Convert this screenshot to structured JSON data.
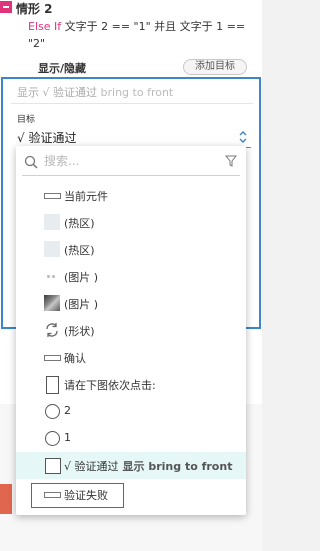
{
  "case": {
    "title": "情形 2"
  },
  "condition": {
    "keyword": "Else If",
    "text": " 文字于 2 == \"1\" 并且 文字于 1 == \"2\""
  },
  "action": {
    "title": "显示/隐藏",
    "add_target_label": "添加目标"
  },
  "editor": {
    "summary_prefix": "显示 √ 验证通过",
    "summary_suffix": "bring to front",
    "target_label": "目标",
    "target_value": "√ 验证通过"
  },
  "dropdown": {
    "search_placeholder": "搜索...",
    "items": [
      {
        "icon": "line-widget-icon",
        "label": "当前元件"
      },
      {
        "icon": "hotspot-icon",
        "label": "(热区)"
      },
      {
        "icon": "hotspot-icon",
        "label": "(热区)"
      },
      {
        "icon": "dots-image-icon",
        "label": "(图片 )"
      },
      {
        "icon": "photo-thumbnail-icon",
        "label": "(图片 )"
      },
      {
        "icon": "refresh-shape-icon",
        "label": "(形状)"
      },
      {
        "icon": "line-widget-icon",
        "label": "确认"
      },
      {
        "icon": "rectangle-icon",
        "label": "请在下图依次点击:"
      },
      {
        "icon": "radio-icon",
        "label": "2"
      },
      {
        "icon": "radio-icon",
        "label": "1"
      },
      {
        "icon": "checkbox-icon",
        "label": "√ 验证通过",
        "extra": "显示 bring to front"
      },
      {
        "icon": "line-widget-icon",
        "label": "验证失败"
      }
    ]
  },
  "colors": {
    "accent": "#3a86c8",
    "keyword": "#e0337a",
    "highlight": "#e6f7f7",
    "mark": "#d23a3a"
  }
}
